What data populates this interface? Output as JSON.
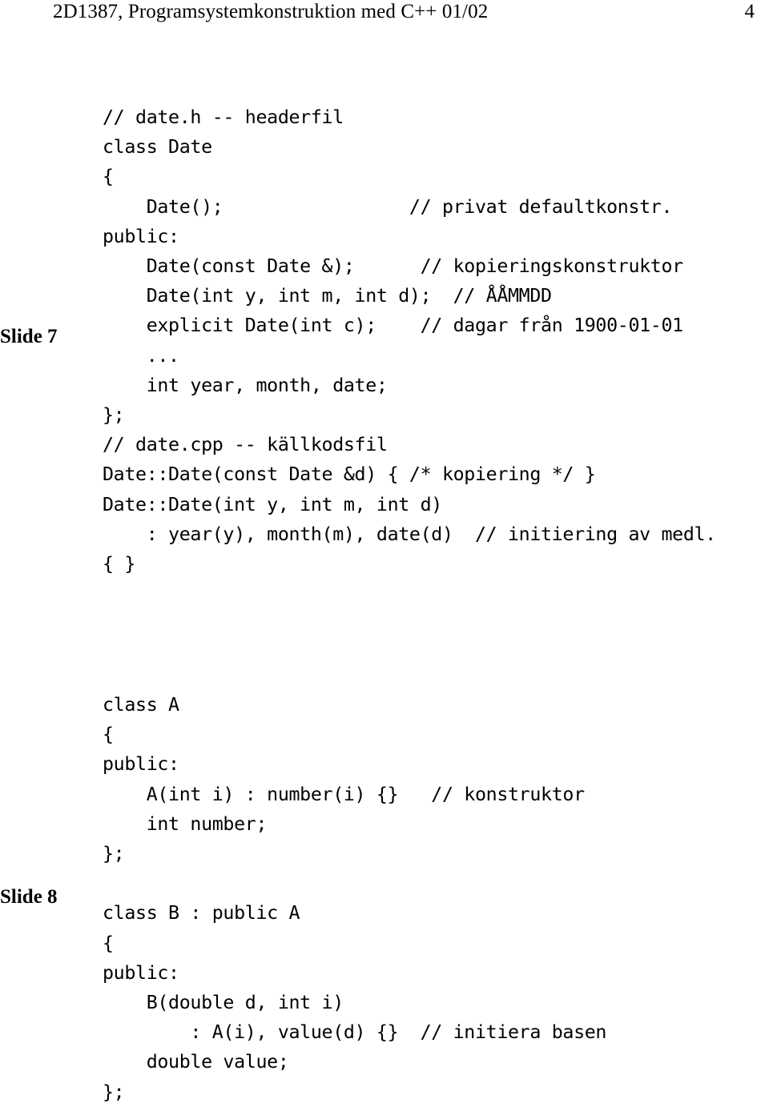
{
  "header": {
    "title": "2D1387, Programsystemkonstruktion med C++ 01/02",
    "page_number": "4"
  },
  "margin_labels": {
    "slide7": "Slide 7",
    "slide8": "Slide 8"
  },
  "code_blocks": [
    {
      "id": "date-class",
      "lines": [
        "// date.h -- headerfil",
        "class Date",
        "{",
        "    Date();                 // privat defaultkonstr.",
        "public:",
        "    Date(const Date &);      // kopieringskonstruktor",
        "    Date(int y, int m, int d);  // ÅÅMMDD",
        "    explicit Date(int c);    // dagar från 1900-01-01",
        "    ...",
        "    int year, month, date;",
        "};",
        "// date.cpp -- källkodsfil",
        "Date::Date(const Date &d) { /* kopiering */ }",
        "Date::Date(int y, int m, int d)",
        "    : year(y), month(m), date(d)  // initiering av medl.",
        "{ }"
      ]
    },
    {
      "id": "inheritance-classes",
      "lines": [
        "class A",
        "{",
        "public:",
        "    A(int i) : number(i) {}   // konstruktor",
        "    int number;",
        "};",
        "",
        "class B : public A",
        "{",
        "public:",
        "    B(double d, int i)",
        "        : A(i), value(d) {}  // initiera basen",
        "    double value;",
        "};"
      ]
    }
  ]
}
